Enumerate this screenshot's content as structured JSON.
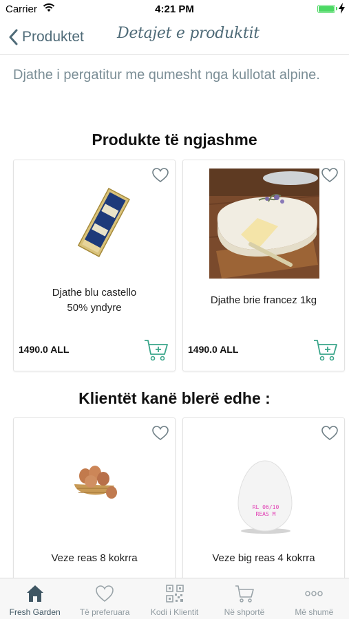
{
  "status_bar": {
    "carrier": "Carrier",
    "time": "4:21 PM"
  },
  "nav": {
    "back_label": "Produktet",
    "title": "Detajet e produktit"
  },
  "description": "Djathe i pergatitur me qumesht nga kullotat alpine.",
  "similar": {
    "title": "Produkte të ngjashme",
    "items": [
      {
        "name_line1": "Djathe blu castello",
        "name_line2": "50% yndyre",
        "price": "1490.0 ALL"
      },
      {
        "name_line1": "Djathe brie francez 1kg",
        "price": "1490.0 ALL"
      }
    ]
  },
  "bought": {
    "title": "Klientët kanë blerë edhe :",
    "items": [
      {
        "name_line1": "Veze reas  8 kokrra"
      },
      {
        "name_line1": "Veze big reas 4 kokrra",
        "egg_stamp_1": "RL 06/10",
        "egg_stamp_2": "REAS M"
      }
    ]
  },
  "tabs": [
    {
      "label": "Fresh Garden",
      "icon": "home-icon",
      "active": true
    },
    {
      "label": "Të preferuara",
      "icon": "heart-icon"
    },
    {
      "label": "Kodi i Klientit",
      "icon": "qr-code-icon"
    },
    {
      "label": "Në shportë",
      "icon": "cart-icon"
    },
    {
      "label": "Më shumë",
      "icon": "more-icon"
    }
  ],
  "colors": {
    "accent": "#4f6b78",
    "cart_green": "#3aa58a",
    "battery": "#4cd964"
  }
}
